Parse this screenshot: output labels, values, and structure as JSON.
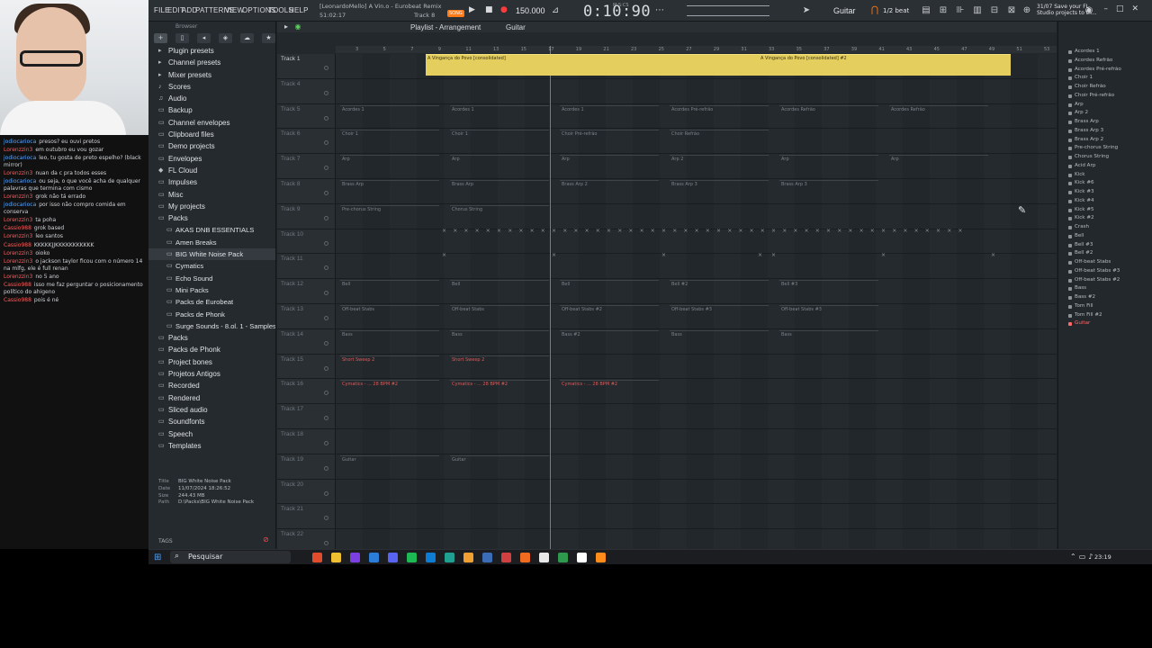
{
  "chat": [
    {
      "user": "jodiocarioca",
      "text": "presos? eu ouvi pretos",
      "color": "blue"
    },
    {
      "user": "Lorenzzin3",
      "text": "em outubro eu vou gozar",
      "color": "red"
    },
    {
      "user": "jodiocarioca",
      "text": "leo, tu gosta de preto espelho? (black mirror)",
      "color": "blue"
    },
    {
      "user": "Lorenzzin3",
      "text": "nuan da c pra todos esses",
      "color": "red"
    },
    {
      "user": "jodiocarioca",
      "text": "ou seja, o que você acha de qualquer palavras que termina com cismo",
      "color": "blue"
    },
    {
      "user": "Lorenzzin3",
      "text": "grok não tá errado",
      "color": "red"
    },
    {
      "user": "jodiocarioca",
      "text": "por isso não compro comida em conserva",
      "color": "blue"
    },
    {
      "user": "Lorenzzin3",
      "text": "ta poha",
      "color": "red"
    },
    {
      "user": "Cassio988",
      "text": "grok based",
      "color": "red"
    },
    {
      "user": "Lorenzzin3",
      "text": "leo santos",
      "color": "red"
    },
    {
      "user": "Cassio988",
      "text": "KKKKKJJKKKKKKKKKKK",
      "color": "red"
    },
    {
      "user": "Lorenzzin3",
      "text": "oioko",
      "color": "red"
    },
    {
      "user": "Lorenzzin3",
      "text": "o jackson taylor ficou com o número 14 na mlfg, ele é full renan",
      "color": "red"
    },
    {
      "user": "Lorenzzin3",
      "text": "no 5 ano",
      "color": "red"
    },
    {
      "user": "Cassio988",
      "text": "isso me faz perguntar o posicionamento político do ahigeno",
      "color": "red"
    },
    {
      "user": "Cassio988",
      "text": "pois é né",
      "color": "red"
    }
  ],
  "menu": [
    "FILE",
    "EDIT",
    "ADD",
    "PATTERNS",
    "VIEW",
    "OPTIONS",
    "TOOLS",
    "HELP"
  ],
  "project": {
    "title": "[LeonardoMello] A Vin.o - Eurobeat Remix",
    "time": "51:02:17",
    "track": "Track 8"
  },
  "transport": {
    "bpm": "150.000",
    "song_badge": "SONG",
    "time": "0:10:90",
    "time_ms": "M:S:CS"
  },
  "snap": {
    "instrument": "Guitar",
    "beat": "1/2 beat"
  },
  "news": {
    "line1": "31/07  Save your FL",
    "line2": "Studio projects to th..."
  },
  "browser": {
    "header": "Browser",
    "items": [
      {
        "label": "Plugin presets",
        "icon": "▸",
        "sub": false
      },
      {
        "label": "Channel presets",
        "icon": "▸",
        "sub": false
      },
      {
        "label": "Mixer presets",
        "icon": "▸",
        "sub": false
      },
      {
        "label": "Scores",
        "icon": "♪",
        "sub": false
      },
      {
        "label": "Audio",
        "icon": "♫",
        "sub": false
      },
      {
        "label": "Backup",
        "icon": "▭",
        "sub": false
      },
      {
        "label": "Channel envelopes",
        "icon": "▭",
        "sub": false
      },
      {
        "label": "Clipboard files",
        "icon": "▭",
        "sub": false
      },
      {
        "label": "Demo projects",
        "icon": "▭",
        "sub": false
      },
      {
        "label": "Envelopes",
        "icon": "▭",
        "sub": false
      },
      {
        "label": "FL Cloud",
        "icon": "◆",
        "sub": false
      },
      {
        "label": "Impulses",
        "icon": "▭",
        "sub": false
      },
      {
        "label": "Misc",
        "icon": "▭",
        "sub": false
      },
      {
        "label": "My projects",
        "icon": "▭",
        "sub": false
      },
      {
        "label": "Packs",
        "icon": "▭",
        "sub": false
      },
      {
        "label": "AKAS DNB ESSENTIALS",
        "icon": "▭",
        "sub": true
      },
      {
        "label": "Amen Breaks",
        "icon": "▭",
        "sub": true
      },
      {
        "label": "BIG White Noise Pack",
        "icon": "▭",
        "sub": true
      },
      {
        "label": "Cymatics",
        "icon": "▭",
        "sub": true
      },
      {
        "label": "Echo Sound",
        "icon": "▭",
        "sub": true
      },
      {
        "label": "Mini Packs",
        "icon": "▭",
        "sub": true
      },
      {
        "label": "Packs de Eurobeat",
        "icon": "▭",
        "sub": true
      },
      {
        "label": "Packs de Phonk",
        "icon": "▭",
        "sub": true
      },
      {
        "label": "Surge Sounds - 8.ol. 1 - Samples",
        "icon": "▭",
        "sub": true
      },
      {
        "label": "Packs",
        "icon": "▭",
        "sub": false
      },
      {
        "label": "Packs de Phonk",
        "icon": "▭",
        "sub": false
      },
      {
        "label": "Project bones",
        "icon": "▭",
        "sub": false
      },
      {
        "label": "Projetos Antigos",
        "icon": "▭",
        "sub": false
      },
      {
        "label": "Recorded",
        "icon": "▭",
        "sub": false
      },
      {
        "label": "Rendered",
        "icon": "▭",
        "sub": false
      },
      {
        "label": "Sliced audio",
        "icon": "▭",
        "sub": false
      },
      {
        "label": "Soundfonts",
        "icon": "▭",
        "sub": false
      },
      {
        "label": "Speech",
        "icon": "▭",
        "sub": false
      },
      {
        "label": "Templates",
        "icon": "▭",
        "sub": false
      }
    ],
    "info": {
      "title_k": "Title",
      "title_v": "BIG White Noise Pack",
      "date_k": "Date",
      "date_v": "11/07/2024 18:26:52",
      "size_k": "Size",
      "size_v": "244.43 MB",
      "path_k": "Path",
      "path_v": "D:\\Packs\\BIG White Noise Pack"
    },
    "tags": "TAGS"
  },
  "playlist": {
    "title": "Playlist - Arrangement",
    "pattern": "Guitar",
    "ruler": [
      "3",
      "5",
      "7",
      "9",
      "11",
      "13",
      "15",
      "17",
      "19",
      "21",
      "23",
      "25",
      "27",
      "29",
      "31",
      "33",
      "35",
      "37",
      "39",
      "41",
      "43",
      "45",
      "47",
      "49",
      "51",
      "53"
    ],
    "tracks": [
      {
        "name": "Track 1",
        "hi": true,
        "clips": [
          {
            "label": "A Vingança do Povo [consolidated]",
            "audio": true
          },
          {
            "label": "A Vingança do Povo [consolidated] #2",
            "audio": true
          }
        ]
      },
      {
        "name": "Track 4",
        "hi": false,
        "clips": []
      },
      {
        "name": "Track 5",
        "hi": false,
        "clips": [
          {
            "label": "Acordes 1"
          },
          {
            "label": "Acordes 1"
          },
          {
            "label": "Acordes 1"
          },
          {
            "label": "Acordes Pré-refrão"
          },
          {
            "label": "Acordes Refrão"
          },
          {
            "label": "Acordes Refrão"
          }
        ]
      },
      {
        "name": "Track 6",
        "hi": false,
        "clips": [
          {
            "label": "Choir 1"
          },
          {
            "label": "Choir 1"
          },
          {
            "label": "Choir Pré-refrão"
          },
          {
            "label": "Choir Refrão"
          }
        ]
      },
      {
        "name": "Track 7",
        "hi": false,
        "clips": [
          {
            "label": "Arp"
          },
          {
            "label": "Arp"
          },
          {
            "label": "Arp"
          },
          {
            "label": "Arp 2"
          },
          {
            "label": "Arp"
          },
          {
            "label": "Arp"
          }
        ]
      },
      {
        "name": "Track 8",
        "hi": false,
        "clips": [
          {
            "label": "Brass Arp"
          },
          {
            "label": "Brass Arp"
          },
          {
            "label": "Brass Arp 2"
          },
          {
            "label": "Brass Arp 3"
          },
          {
            "label": "Brass Arp 3"
          }
        ]
      },
      {
        "name": "Track 9",
        "hi": false,
        "clips": [
          {
            "label": "Pre-chorus String"
          },
          {
            "label": "Chorus String"
          }
        ]
      },
      {
        "name": "Track 10",
        "hi": false,
        "clips": []
      },
      {
        "name": "Track 11",
        "hi": false,
        "clips": []
      },
      {
        "name": "Track 12",
        "hi": false,
        "clips": [
          {
            "label": "Bell"
          },
          {
            "label": "Bell"
          },
          {
            "label": "Bell"
          },
          {
            "label": "Bell #2"
          },
          {
            "label": "Bell #3"
          }
        ]
      },
      {
        "name": "Track 13",
        "hi": false,
        "clips": [
          {
            "label": "Off-beat Stabs"
          },
          {
            "label": "Off-beat Stabs"
          },
          {
            "label": "Off-beat Stabs #2"
          },
          {
            "label": "Off-beat Stabs #3"
          },
          {
            "label": "Off-beat Stabs #3"
          }
        ]
      },
      {
        "name": "Track 14",
        "hi": false,
        "clips": [
          {
            "label": "Bass"
          },
          {
            "label": "Bass"
          },
          {
            "label": "Bass #2"
          },
          {
            "label": "Bass"
          },
          {
            "label": "Bass"
          }
        ]
      },
      {
        "name": "Track 15",
        "hi": false,
        "clips": [
          {
            "label": "Short Sweep 2",
            "red": true
          },
          {
            "label": "Short Sweep 2",
            "red": true
          }
        ]
      },
      {
        "name": "Track 16",
        "hi": false,
        "clips": [
          {
            "label": "Cymatics - ... 28 BPM #2",
            "red": true
          },
          {
            "label": "Cymatics - ... 28 BPM #2",
            "red": true
          },
          {
            "label": "Cymatics - ... 28 BPM #2",
            "red": true
          }
        ]
      },
      {
        "name": "Track 17",
        "hi": false,
        "clips": []
      },
      {
        "name": "Track 18",
        "hi": false,
        "clips": []
      },
      {
        "name": "Track 19",
        "hi": false,
        "clips": [
          {
            "label": "Guitar"
          },
          {
            "label": "Guitar"
          }
        ]
      },
      {
        "name": "Track 20",
        "hi": false,
        "clips": []
      },
      {
        "name": "Track 21",
        "hi": false,
        "clips": []
      },
      {
        "name": "Track 22",
        "hi": false,
        "clips": []
      }
    ]
  },
  "channels": [
    "Acordes 1",
    "Acordes Refrão",
    "Acordes Pré-refrão",
    "Choir 1",
    "Choir Refrão",
    "Choir Pré-refrão",
    "Arp",
    "Arp 2",
    "Brass Arp",
    "Brass Arp 3",
    "Brass Arp 2",
    "Pre-chorus String",
    "Chorus String",
    "Acid Arp",
    "Kick",
    "Kick #6",
    "Kick #3",
    "Kick #4",
    "Kick #5",
    "Kick #2",
    "Crash",
    "Bell",
    "Bell #3",
    "Bell #2",
    "Off-beat Stabs",
    "Off-beat Stabs #3",
    "Off-beat Stabs #2",
    "Bass",
    "Bass #2",
    "Tom Fill",
    "Tom Fill #2",
    "Guitar"
  ],
  "selected_channel": "Guitar",
  "taskbar": {
    "search": "Pesquisar",
    "clock": "23:19"
  },
  "colors": {
    "accent": "#ff7a18",
    "audio_clip": "#e4ce5e",
    "chat_blue": "#4ea4ff",
    "chat_red": "#ff5a5a"
  }
}
